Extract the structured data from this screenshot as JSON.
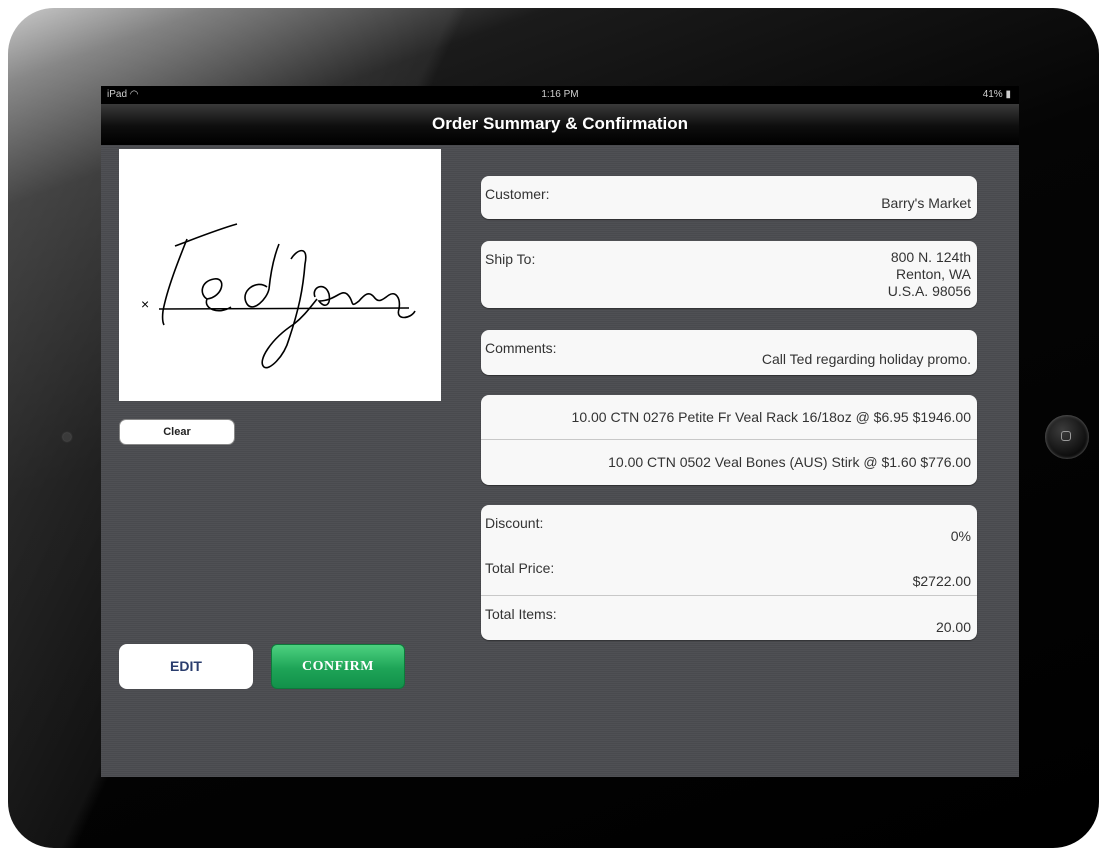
{
  "status_bar": {
    "carrier": "iPad",
    "time": "1:16 PM",
    "battery": "41%"
  },
  "nav": {
    "title": "Order Summary & Confirmation"
  },
  "signature": {
    "x_mark": "×",
    "signature_text": "Ted Jones"
  },
  "buttons": {
    "clear": "Clear",
    "edit": "EDIT",
    "confirm": "CONFIRM"
  },
  "customer": {
    "label": "Customer:",
    "value": "Barry's Market"
  },
  "ship_to": {
    "label": "Ship To:",
    "lines": [
      "800 N. 124th",
      "Renton, WA",
      "U.S.A. 98056"
    ]
  },
  "comments": {
    "label": "Comments:",
    "value": "Call Ted regarding holiday promo."
  },
  "items": [
    "10.00 CTN 0276 Petite Fr Veal Rack 16/18oz @ $6.95 $1946.00",
    "10.00 CTN 0502 Veal Bones (AUS) Stirk @ $1.60 $776.00"
  ],
  "totals": [
    {
      "label": "Discount:",
      "value": "0%"
    },
    {
      "label": "Total Price:",
      "value": "$2722.00"
    },
    {
      "label": "Total Items:",
      "value": "20.00"
    }
  ],
  "colors": {
    "confirm_green": "#1ea457",
    "edit_text": "#2a3d6e",
    "screen_bg": "#4b4c50"
  }
}
